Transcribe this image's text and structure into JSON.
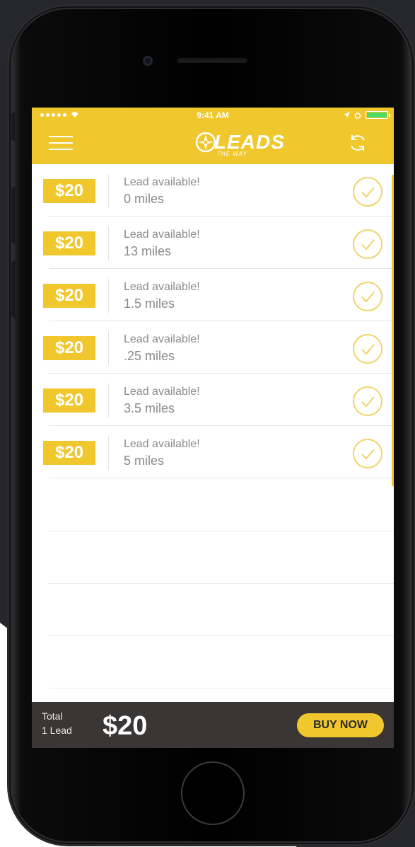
{
  "status_bar": {
    "time": "9:41 AM"
  },
  "header": {
    "logo_text": "LEADS",
    "logo_tagline": "THE WAY",
    "menu_icon": "hamburger-menu-icon",
    "refresh_icon": "refresh-icon"
  },
  "leads": [
    {
      "price": "$20",
      "title": "Lead available!",
      "distance": "0 miles"
    },
    {
      "price": "$20",
      "title": "Lead available!",
      "distance": "13 miles"
    },
    {
      "price": "$20",
      "title": "Lead available!",
      "distance": "1.5 miles"
    },
    {
      "price": "$20",
      "title": "Lead available!",
      "distance": ".25 miles"
    },
    {
      "price": "$20",
      "title": "Lead available!",
      "distance": "3.5 miles"
    },
    {
      "price": "$20",
      "title": "Lead available!",
      "distance": "5 miles"
    }
  ],
  "footer": {
    "total_label": "Total",
    "lead_count": "1 Lead",
    "total_amount": "$20",
    "buy_label": "BUY NOW"
  },
  "colors": {
    "accent": "#f1c72e",
    "footer_bg": "#3a3635",
    "text_muted": "#8a8a8a"
  }
}
